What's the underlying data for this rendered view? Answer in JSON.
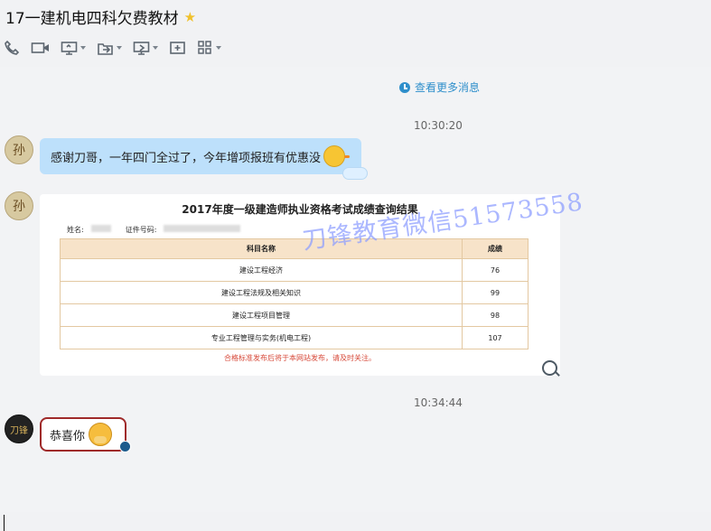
{
  "window": {
    "title": "17一建机电四科欠费教材",
    "starred": true
  },
  "toolbar": {
    "items": [
      "phone-icon",
      "video-icon",
      "screen-share-icon",
      "transfer-icon",
      "remote-desktop-icon",
      "add-member-icon",
      "apps-icon"
    ]
  },
  "chat": {
    "load_more": "查看更多消息",
    "time1": "10:30:20",
    "avatar1": "孙",
    "message1": "感谢刀哥，一年四门全过了，今年增项报班有优惠没",
    "avatar2": "孙",
    "result_card": {
      "title": "2017年度一级建造师执业资格考试成绩查询结果",
      "name_label": "姓名:",
      "id_label": "证件号码:",
      "headers": [
        "科目名称",
        "成绩"
      ],
      "rows": [
        [
          "建设工程经济",
          "76"
        ],
        [
          "建设工程法规及相关知识",
          "99"
        ],
        [
          "建设工程项目管理",
          "98"
        ],
        [
          "专业工程管理与实务(机电工程)",
          "107"
        ]
      ],
      "notice": "合格标准发布后将于本网站发布，请及时关注。",
      "watermark": "刀锋教育微信51573558"
    },
    "time2": "10:34:44",
    "avatar3": "刀锋",
    "message2": "恭喜你"
  }
}
